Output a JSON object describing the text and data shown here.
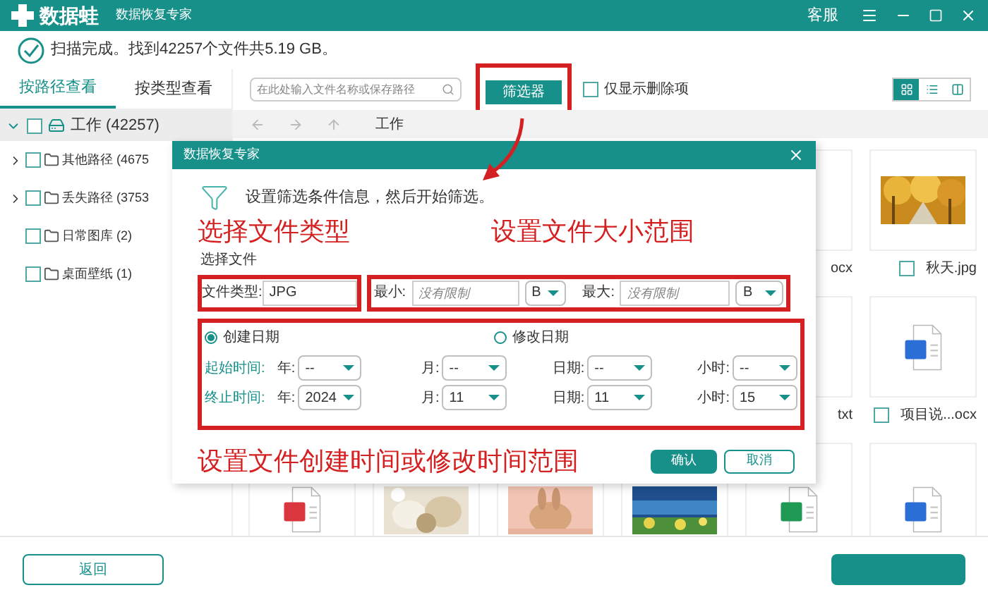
{
  "app": {
    "logo_text": "数据蛙",
    "subtitle": "数据恢复专家",
    "support": "客服"
  },
  "scan_status": "扫描完成。找到42257个文件共5.19 GB。",
  "sidebar": {
    "tabs": [
      {
        "label": "按路径查看",
        "selected": true
      },
      {
        "label": "按类型查看",
        "selected": false
      }
    ],
    "tree": [
      {
        "label": "工作 (42257)",
        "expanded": true,
        "selected": true,
        "checked": false,
        "children": [
          {
            "label": "其他路径 (4675",
            "expandable": true,
            "checked": false
          },
          {
            "label": "丢失路径 (3753",
            "expandable": true,
            "checked": false
          },
          {
            "label": "日常图库 (2)",
            "expandable": false,
            "checked": false
          },
          {
            "label": "桌面壁纸 (1)",
            "expandable": false,
            "checked": false
          }
        ]
      }
    ]
  },
  "toolbar": {
    "search": {
      "placeholder": "在此处输入文件名称或保存路径"
    },
    "filter_button": "筛选器",
    "deleted_only": {
      "label": "仅显示删除项",
      "checked": false
    },
    "view_modes": [
      {
        "kind": "grid",
        "selected": true
      },
      {
        "kind": "list",
        "selected": false
      },
      {
        "kind": "detail",
        "selected": false
      }
    ]
  },
  "path_bar": {
    "current": "工作"
  },
  "file_rows": [
    [
      {
        "kind": "blank",
        "label": "ocx"
      },
      {
        "kind": "picture",
        "label": "秋天.jpg",
        "checked": false
      }
    ],
    [
      {
        "kind": "blank",
        "label": "txt"
      },
      {
        "kind": "word",
        "label": "项目说...ocx",
        "checked": false
      }
    ],
    [
      {
        "kind": "pdf"
      },
      {
        "kind": "picture"
      },
      {
        "kind": "picture"
      },
      {
        "kind": "picture"
      },
      {
        "kind": "sheet"
      },
      {
        "kind": "word"
      }
    ]
  ],
  "dialog": {
    "title": "数据恢复专家",
    "intro": "设置筛选条件信息，然后开始筛选。",
    "section": "选择文件",
    "file_type": {
      "label": "文件类型:",
      "value": "JPG"
    },
    "size": {
      "min_label": "最小:",
      "min_placeholder": "没有限制",
      "min_unit": "B",
      "max_label": "最大:",
      "max_placeholder": "没有限制",
      "max_unit": "B"
    },
    "date_modes": [
      {
        "label": "创建日期",
        "selected": true
      },
      {
        "label": "修改日期",
        "selected": false
      }
    ],
    "time_rows": [
      {
        "label": "起始时间:",
        "fields": [
          {
            "label": "年:",
            "value": "--"
          },
          {
            "label": "月:",
            "value": "--"
          },
          {
            "label": "日期:",
            "value": "--"
          },
          {
            "label": "小时:",
            "value": "--"
          }
        ]
      },
      {
        "label": "终止时间:",
        "fields": [
          {
            "label": "年:",
            "value": "2024"
          },
          {
            "label": "月:",
            "value": "11"
          },
          {
            "label": "日期:",
            "value": "11"
          },
          {
            "label": "小时:",
            "value": "15"
          }
        ]
      }
    ],
    "confirm_button": "确认",
    "cancel_button": "取消"
  },
  "annotations": {
    "file_type": "选择文件类型",
    "file_size": "设置文件大小范围",
    "time_range": "设置文件创建时间或修改时间范围"
  },
  "footer": {
    "back_button": "返回"
  }
}
